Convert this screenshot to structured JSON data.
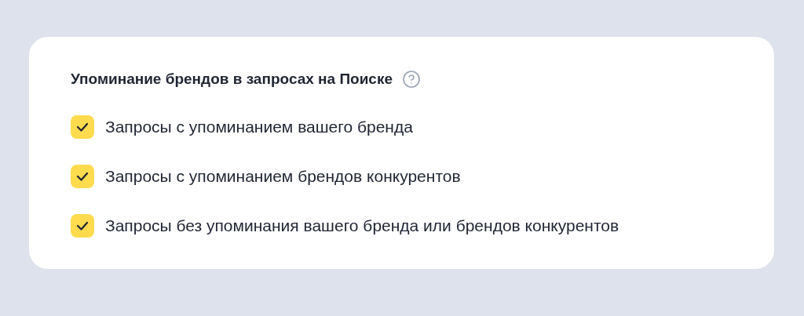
{
  "card": {
    "title": "Упоминание брендов в запросах на Поиске",
    "options": [
      {
        "label": "Запросы с упоминанием вашего бренда",
        "checked": true
      },
      {
        "label": "Запросы с упоминанием брендов конкурентов",
        "checked": true
      },
      {
        "label": "Запросы без упоминания вашего бренда или брендов конкурентов",
        "checked": true
      }
    ]
  }
}
